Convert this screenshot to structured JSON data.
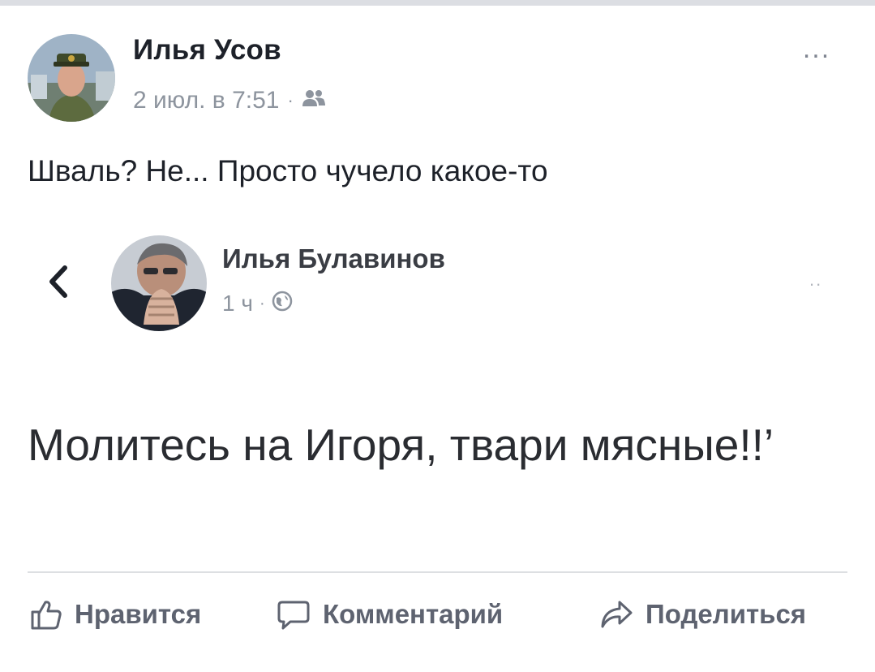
{
  "post": {
    "author": "Илья Усов",
    "date": "2 июл. в 7:51",
    "meta_separator": "·",
    "audience_icon": "friends-icon",
    "more_label": "...",
    "text": "Шваль? Не... Просто чучело какое-то"
  },
  "embedded": {
    "author": "Илья Булавинов",
    "time": "1 ч",
    "meta_separator": "·",
    "audience_icon": "globe-icon",
    "back_icon": "chevron-left-icon",
    "more_label": "..",
    "text": "Молитесь на Игоря, твари мясные!!’"
  },
  "actions": {
    "like": {
      "label": "Нравится",
      "icon": "thumbs-up-icon"
    },
    "comment": {
      "label": "Комментарий",
      "icon": "comment-icon"
    },
    "share": {
      "label": "Поделиться",
      "icon": "share-icon"
    }
  },
  "colors": {
    "text_primary": "#1d2129",
    "text_secondary": "#8d949e",
    "action_text": "#5e6370",
    "divider": "#dddfe2"
  }
}
